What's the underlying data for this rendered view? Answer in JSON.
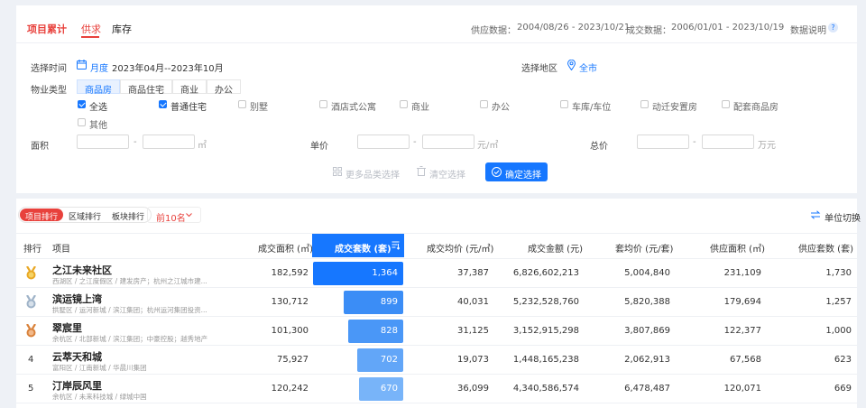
{
  "tabs": [
    {
      "label": "项目累计"
    },
    {
      "label": "供求"
    },
    {
      "label": "库存"
    }
  ],
  "supply_range": {
    "label": "供应数据：",
    "value": "2004/08/26 - 2023/10/21"
  },
  "deal_range": {
    "label": "成交数据：",
    "value": "2006/01/01 - 2023/10/19"
  },
  "data_note": "数据说明",
  "filters": {
    "time_label": "选择时间",
    "time_mode": "月度",
    "time_range": "2023年04月--2023年10月",
    "region_label": "选择地区",
    "region_value": "全市",
    "property_label": "物业类型",
    "property_tabs": [
      "商品房",
      "商品住宅",
      "商业",
      "办公"
    ],
    "checkboxes": [
      {
        "label": "全选",
        "checked": true
      },
      {
        "label": "普通住宅",
        "checked": true
      },
      {
        "label": "别墅",
        "checked": false
      },
      {
        "label": "酒店式公寓",
        "checked": false
      },
      {
        "label": "商业",
        "checked": false
      },
      {
        "label": "办公",
        "checked": false
      },
      {
        "label": "车库/车位",
        "checked": false
      },
      {
        "label": "动迁安置房",
        "checked": false
      },
      {
        "label": "配套商品房",
        "checked": false
      },
      {
        "label": "其他",
        "checked": false
      }
    ],
    "area_label": "面积",
    "area_unit": "㎡",
    "price_label": "单价",
    "price_unit": "元/㎡",
    "total_label": "总价",
    "total_unit": "万元",
    "dash": "-",
    "more_label": "更多品类选择",
    "clear_label": "清空选择",
    "confirm_label": "确定选择"
  },
  "ranking": {
    "tabs": [
      "项目排行",
      "区域排行",
      "板块排行"
    ],
    "top_select": "前10名",
    "unit_switch": "单位切换"
  },
  "table": {
    "headers": {
      "rank": "排行",
      "project": "项目",
      "deal_area": "成交面积 (㎡)",
      "deal_units": "成交套数 (套)",
      "avg_price": "成交均价 (元/㎡)",
      "deal_amount": "成交金额 (元)",
      "unit_price": "套均价 (元/套)",
      "supply_area": "供应面积 (㎡)",
      "supply_units": "供应套数 (套)"
    },
    "rows": [
      {
        "rank": "1",
        "name": "之江未来社区",
        "sub": "西湖区 / 之江度假区 / 建发房产；杭州之江城市建...",
        "deal_area": "182,592",
        "deal_units": 1364,
        "deal_units_text": "1,364",
        "avg_price": "37,387",
        "deal_amount": "6,826,602,213",
        "unit_price": "5,004,840",
        "supply_area": "231,109",
        "supply_units": "1,730"
      },
      {
        "rank": "2",
        "name": "滨运镜上湾",
        "sub": "拱墅区 / 运河新城 / 滨江集团；杭州运河集团投资...",
        "deal_area": "130,712",
        "deal_units": 899,
        "deal_units_text": "899",
        "avg_price": "40,031",
        "deal_amount": "5,232,528,760",
        "unit_price": "5,820,388",
        "supply_area": "179,694",
        "supply_units": "1,257"
      },
      {
        "rank": "3",
        "name": "翠宸里",
        "sub": "余杭区 / 北部新城 / 滨江集团；中豪控股；越秀地产",
        "deal_area": "101,300",
        "deal_units": 828,
        "deal_units_text": "828",
        "avg_price": "31,125",
        "deal_amount": "3,152,915,298",
        "unit_price": "3,807,869",
        "supply_area": "122,377",
        "supply_units": "1,000"
      },
      {
        "rank": "4",
        "name": "云萃天和城",
        "sub": "富阳区 / 江南新城 / 华晨川集团",
        "deal_area": "75,927",
        "deal_units": 702,
        "deal_units_text": "702",
        "avg_price": "19,073",
        "deal_amount": "1,448,165,238",
        "unit_price": "2,062,913",
        "supply_area": "67,568",
        "supply_units": "623"
      },
      {
        "rank": "5",
        "name": "汀岸辰风里",
        "sub": "余杭区 / 未来科技城 / 绿城中国",
        "deal_area": "120,242",
        "deal_units": 670,
        "deal_units_text": "670",
        "avg_price": "36,099",
        "deal_amount": "4,340,586,574",
        "unit_price": "6,478,487",
        "supply_area": "120,071",
        "supply_units": "669"
      }
    ]
  },
  "colors": {
    "accent": "#1677ff",
    "tab_active": "#e8413c",
    "rank_active_bg": "#e8413c",
    "bar_colors": [
      "#1677ff",
      "#3b8df6",
      "#4a97f7",
      "#62a6f8",
      "#78b4f9"
    ]
  }
}
